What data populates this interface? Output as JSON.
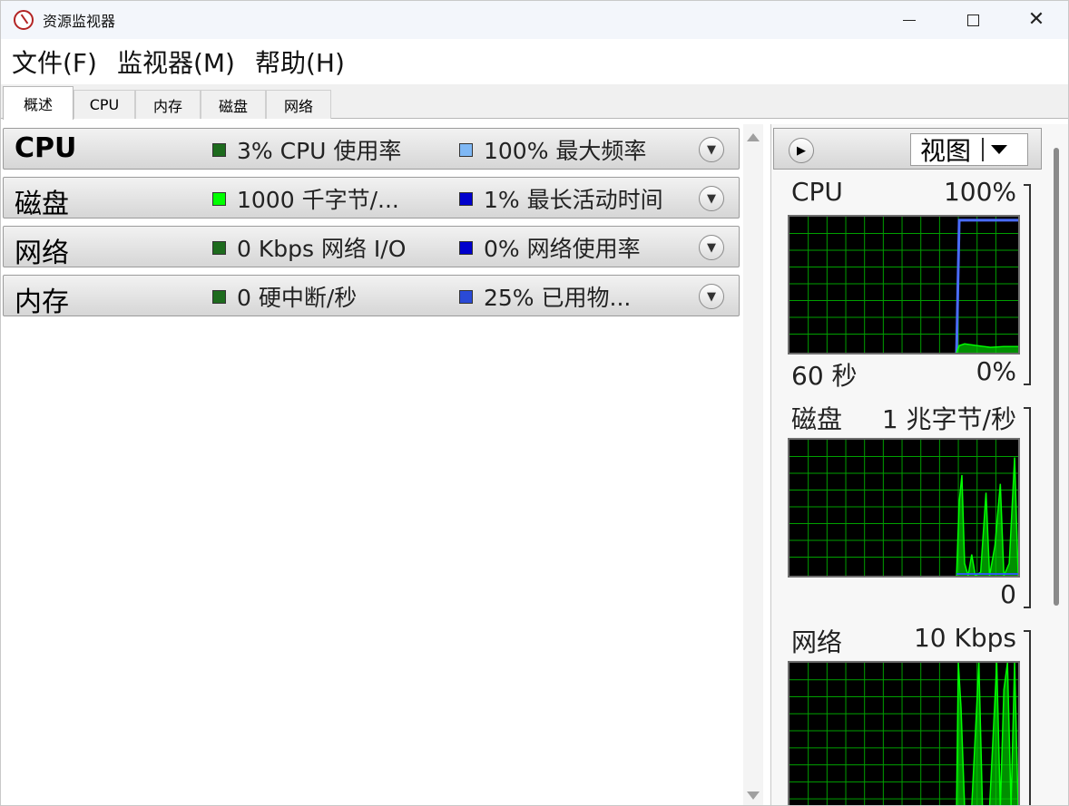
{
  "window": {
    "title": "资源监视器"
  },
  "menu": [
    "文件(F)",
    "监视器(M)",
    "帮助(H)"
  ],
  "tabs": [
    {
      "label": "概述",
      "active": true
    },
    {
      "label": "CPU",
      "active": false
    },
    {
      "label": "内存",
      "active": false
    },
    {
      "label": "磁盘",
      "active": false
    },
    {
      "label": "网络",
      "active": false
    }
  ],
  "sections": [
    {
      "title": "CPU",
      "metric1": "3% CPU 使用率",
      "metric1_color": "#1d6b1d",
      "metric2": "100% 最大频率",
      "metric2_color": "#7fb8f5"
    },
    {
      "title": "磁盘",
      "metric1": "1000 千字节/...",
      "metric1_color": "#00ff00",
      "metric2": "1% 最长活动时间",
      "metric2_color": "#0000cc"
    },
    {
      "title": "网络",
      "metric1": "0 Kbps 网络 I/O",
      "metric1_color": "#1d6b1d",
      "metric2": "0% 网络使用率",
      "metric2_color": "#0000cc"
    },
    {
      "title": "内存",
      "metric1": "0 硬中断/秒",
      "metric1_color": "#1d6b1d",
      "metric2": "25% 已用物...",
      "metric2_color": "#2a4ad6"
    }
  ],
  "right_panel": {
    "view_label": "视图",
    "cpu_graph": {
      "title": "CPU",
      "max": "100%",
      "time": "60 秒",
      "min": "0%"
    },
    "disk_graph": {
      "title": "磁盘",
      "max": "1 兆字节/秒",
      "min": "0"
    },
    "net_graph": {
      "title": "网络",
      "max": "10 Kbps"
    }
  },
  "icons": {
    "app": "resource-monitor-icon",
    "expand": "chevron-down-icon",
    "panel_toggle": "chevron-right-icon",
    "dropdown": "caret-down-icon"
  }
}
